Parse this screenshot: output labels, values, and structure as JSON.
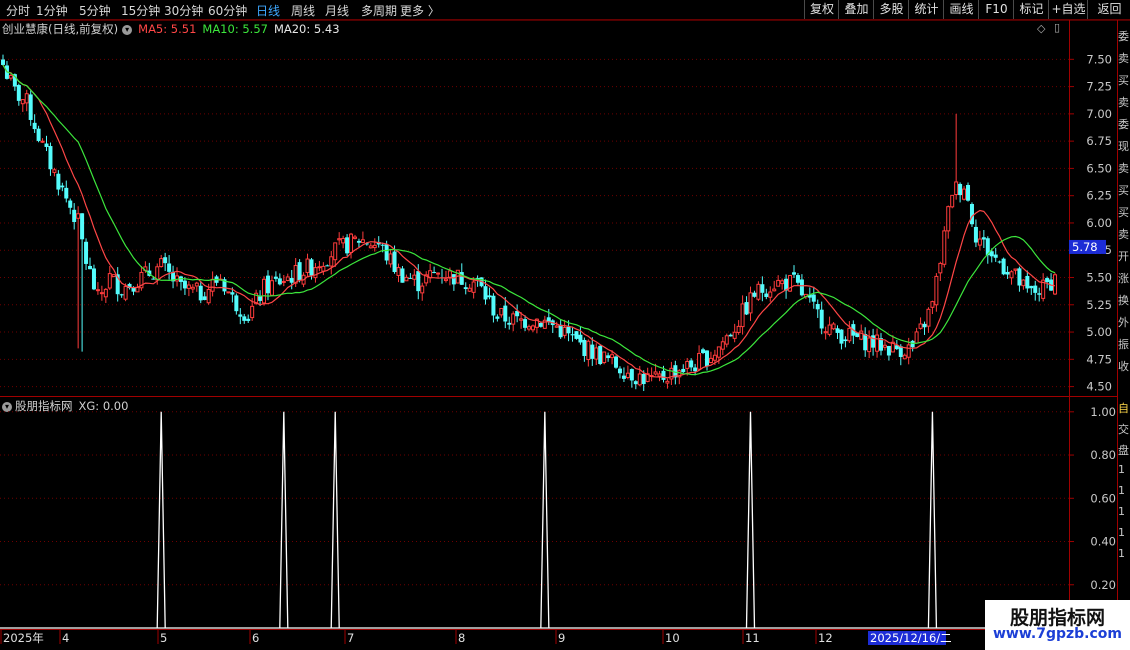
{
  "toolbar": {
    "periods": [
      "分时",
      "1分钟",
      "5分钟",
      "15分钟",
      "30分钟",
      "60分钟",
      "日线",
      "周线",
      "月线",
      "多周期",
      "更多"
    ],
    "active_period": "日线",
    "right_buttons": [
      "复权",
      "叠加",
      "多股",
      "统计",
      "画线",
      "F10",
      "标记",
      "+自选",
      "返回"
    ]
  },
  "price_header": {
    "stock_name": "创业慧康(日线,前复权)",
    "ma5_label": "MA5: 5.51",
    "ma10_label": "MA10: 5.57",
    "ma20_label": "MA20: 5.43"
  },
  "indicator_header": {
    "name": "股朋指标网",
    "value_label": "XG: 0.00"
  },
  "price_axis": {
    "labels": [
      "7.50",
      "7.25",
      "7.00",
      "6.75",
      "6.50",
      "6.25",
      "6.00",
      "5.75",
      "5.50",
      "5.25",
      "5.00",
      "4.75",
      "4.50"
    ]
  },
  "indicator_axis": {
    "labels": [
      "1.00",
      "0.80",
      "0.60",
      "0.40",
      "0.20"
    ]
  },
  "current_price_tag": "5.78",
  "date_axis": {
    "labels": [
      "2025年",
      "4",
      "5",
      "6",
      "7",
      "8",
      "9",
      "10",
      "11",
      "12"
    ],
    "cursor_date": "2025/12/16/二"
  },
  "right_strip_chars": [
    "委",
    "卖",
    "买",
    "卖",
    "委",
    "现",
    "卖",
    "买",
    "买",
    "卖",
    "开",
    "涨",
    "换",
    "外",
    "振",
    "收"
  ],
  "right_strip_lower_chars": [
    "自",
    "交",
    "盘",
    "1",
    "1",
    "1",
    "1",
    "1"
  ],
  "watermark": {
    "line1": "股朋指标网",
    "line2": "www.7gpzb.com"
  },
  "colors": {
    "up": "#ff3c3c",
    "down": "#54fcfc",
    "ma5": "#ff4646",
    "ma10": "#e6e632",
    "ma20": "#3ce63c",
    "grid": "#6e0000",
    "border": "#a00000",
    "signal": "#ffffff",
    "tag_bg": "#1c2cd6"
  },
  "chart_data": {
    "type": "candlestick",
    "price_range": [
      4.4,
      7.7
    ],
    "indicator_range": [
      0,
      1.05
    ],
    "anchors": [
      [
        0,
        7.45
      ],
      [
        3,
        7.2
      ],
      [
        6,
        7.1
      ],
      [
        10,
        6.7
      ],
      [
        15,
        6.3
      ],
      [
        19,
        6.0
      ],
      [
        21,
        5.65
      ],
      [
        24,
        5.3
      ],
      [
        27,
        5.5
      ],
      [
        30,
        5.4
      ],
      [
        35,
        5.5
      ],
      [
        40,
        5.6
      ],
      [
        45,
        5.4
      ],
      [
        50,
        5.35
      ],
      [
        55,
        5.5
      ],
      [
        58,
        5.3
      ],
      [
        62,
        5.15
      ],
      [
        66,
        5.4
      ],
      [
        72,
        5.5
      ],
      [
        78,
        5.6
      ],
      [
        84,
        5.75
      ],
      [
        90,
        5.85
      ],
      [
        95,
        5.8
      ],
      [
        100,
        5.55
      ],
      [
        105,
        5.45
      ],
      [
        110,
        5.55
      ],
      [
        115,
        5.5
      ],
      [
        120,
        5.45
      ],
      [
        125,
        5.15
      ],
      [
        130,
        5.1
      ],
      [
        135,
        5.12
      ],
      [
        140,
        5.05
      ],
      [
        145,
        4.9
      ],
      [
        150,
        4.8
      ],
      [
        155,
        4.7
      ],
      [
        160,
        4.6
      ],
      [
        165,
        4.55
      ],
      [
        170,
        4.65
      ],
      [
        175,
        4.7
      ],
      [
        180,
        4.82
      ],
      [
        185,
        5.05
      ],
      [
        190,
        5.35
      ],
      [
        195,
        5.45
      ],
      [
        200,
        5.45
      ],
      [
        205,
        5.2
      ],
      [
        210,
        5.0
      ],
      [
        215,
        4.95
      ],
      [
        220,
        4.9
      ],
      [
        225,
        4.85
      ],
      [
        230,
        4.85
      ],
      [
        235,
        5.25
      ],
      [
        240,
        6.3
      ],
      [
        243,
        6.35
      ],
      [
        246,
        5.9
      ],
      [
        250,
        5.7
      ],
      [
        255,
        5.55
      ],
      [
        259,
        5.35
      ],
      [
        263,
        5.4
      ],
      [
        266,
        5.5
      ]
    ],
    "signal_bars": [
      40,
      71,
      84,
      137,
      189,
      235
    ]
  }
}
